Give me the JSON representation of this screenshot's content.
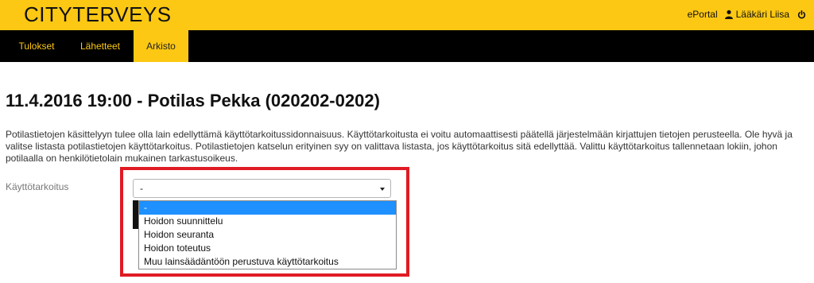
{
  "header": {
    "brand": "CITYTERVEYS",
    "eportal_label": "ePortal",
    "user_name": "Lääkäri Liisa",
    "user_icon": "user-icon",
    "logout_icon": "power-icon",
    "background_color": "#fcc813"
  },
  "nav": {
    "tabs": [
      {
        "label": "Tulokset",
        "active": false
      },
      {
        "label": "Lähetteet",
        "active": false
      },
      {
        "label": "Arkisto",
        "active": true
      }
    ],
    "background_color": "#000000",
    "accent_color": "#fcc813"
  },
  "main": {
    "title": "11.4.2016 19:00 - Potilas Pekka (020202-0202)",
    "intro_text": "Potilastietojen käsittelyyn tulee olla lain edellyttämä käyttötarkoitussidonnaisuus. Käyttötarkoitusta ei voitu automaattisesti päätellä järjestelmään kirjattujen tietojen perusteella. Ole hyvä ja valitse listasta potilastietojen käyttötarkoitus. Potilastietojen katselun erityinen syy on valittava listasta, jos käyttötarkoitus sitä edellyttää. Valittu käyttötarkoitus tallennetaan lokiin, johon potilaalla on henkilötietolain mukainen tarkastusoikeus.",
    "purpose_label": "Käyttötarkoitus",
    "purpose_select": {
      "selected_value": "-",
      "options": [
        "-",
        "Hoidon suunnittelu",
        "Hoidon seuranta",
        "Hoidon toteutus",
        "Muu lainsäädäntöön perustuva käyttötarkoitus"
      ],
      "highlighted_option": "-"
    },
    "annotation_color": "#e01b24",
    "selection_color": "#1e90ff"
  }
}
